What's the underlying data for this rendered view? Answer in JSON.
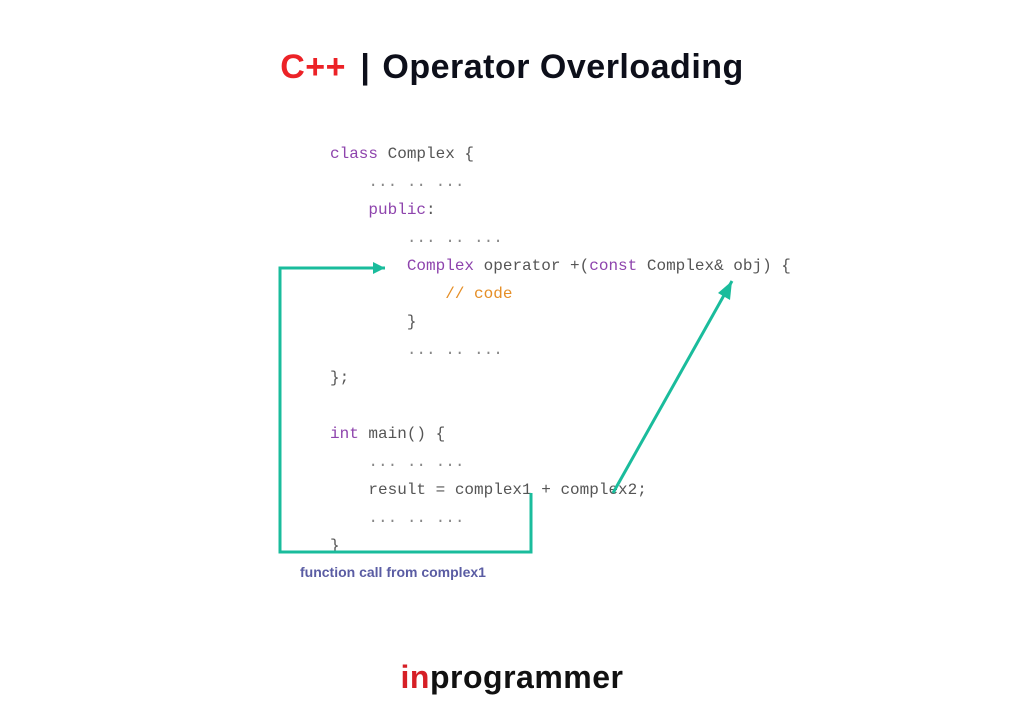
{
  "title": {
    "cpp": "C++",
    "sep": "|",
    "main": "Operator Overloading"
  },
  "code": {
    "l1a": "class",
    "l1b": " Complex {",
    "l2": "    ... .. ...",
    "l3": "    public",
    "l3b": ":",
    "l4": "        ... .. ...",
    "l5a": "        Complex",
    "l5b": " operator +(",
    "l5c": "const",
    "l5d": " Complex& obj) {",
    "l6": "            // code",
    "l7": "        }",
    "l8": "        ... .. ...",
    "l9": "};",
    "blank": "",
    "l10a": "int",
    "l10b": " main() {",
    "l11": "    ... .. ...",
    "l12": "    result = complex1 + complex2;",
    "l13": "    ... .. ...",
    "l14": "}"
  },
  "annotation": "function call from complex1",
  "brand": {
    "in": "in",
    "rest": "programmer"
  },
  "colors": {
    "accent_red": "#ec2227",
    "keyword_purple": "#8e44ad",
    "comment_orange": "#e58e26",
    "arrow_teal": "#1abc9c",
    "annotation": "#5a5ca3"
  }
}
